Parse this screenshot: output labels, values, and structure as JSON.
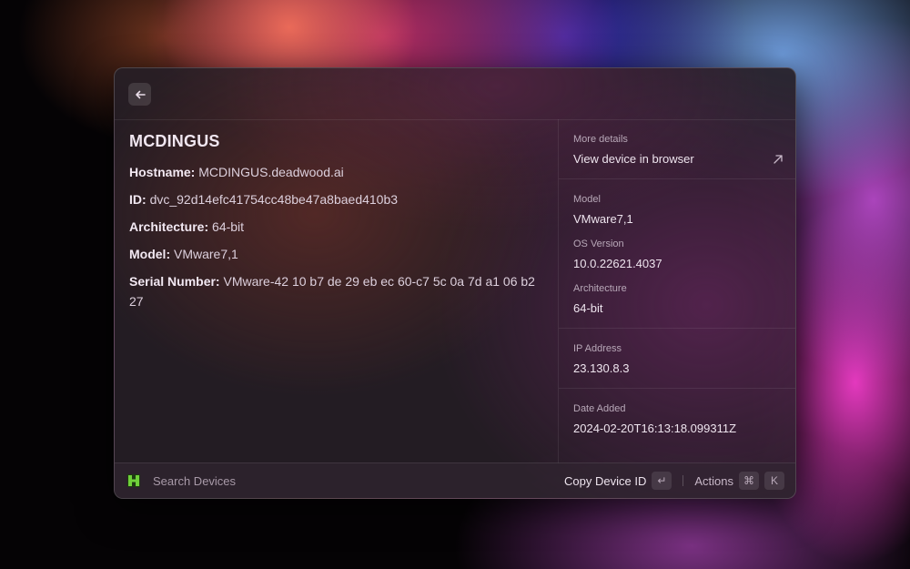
{
  "device": {
    "title": "MCDINGUS",
    "fields": [
      {
        "label": "Hostname:",
        "value": "MCDINGUS.deadwood.ai"
      },
      {
        "label": "ID:",
        "value": "dvc_92d14efc41754cc48be47a8baed410b3"
      },
      {
        "label": "Architecture:",
        "value": "64-bit"
      },
      {
        "label": "Model:",
        "value": "VMware7,1"
      },
      {
        "label": "Serial Number:",
        "value": "VMware-42 10 b7 de 29 eb ec 60-c7 5c 0a 7d a1 06 b2 27"
      }
    ]
  },
  "sidebar": {
    "more_details_label": "More details",
    "view_in_browser": "View device in browser",
    "model_label": "Model",
    "model_value": "VMware7,1",
    "os_label": "OS Version",
    "os_value": "10.0.22621.4037",
    "arch_label": "Architecture",
    "arch_value": "64-bit",
    "ip_label": "IP Address",
    "ip_value": "23.130.8.3",
    "date_label": "Date Added",
    "date_value": "2024-02-20T16:13:18.099311Z"
  },
  "footer": {
    "search_placeholder": "Search Devices",
    "primary_action": "Copy Device ID",
    "enter_key": "↵",
    "actions_label": "Actions",
    "cmd_key": "⌘",
    "k_key": "K"
  },
  "colors": {
    "logo_green": "#6fd13a"
  }
}
